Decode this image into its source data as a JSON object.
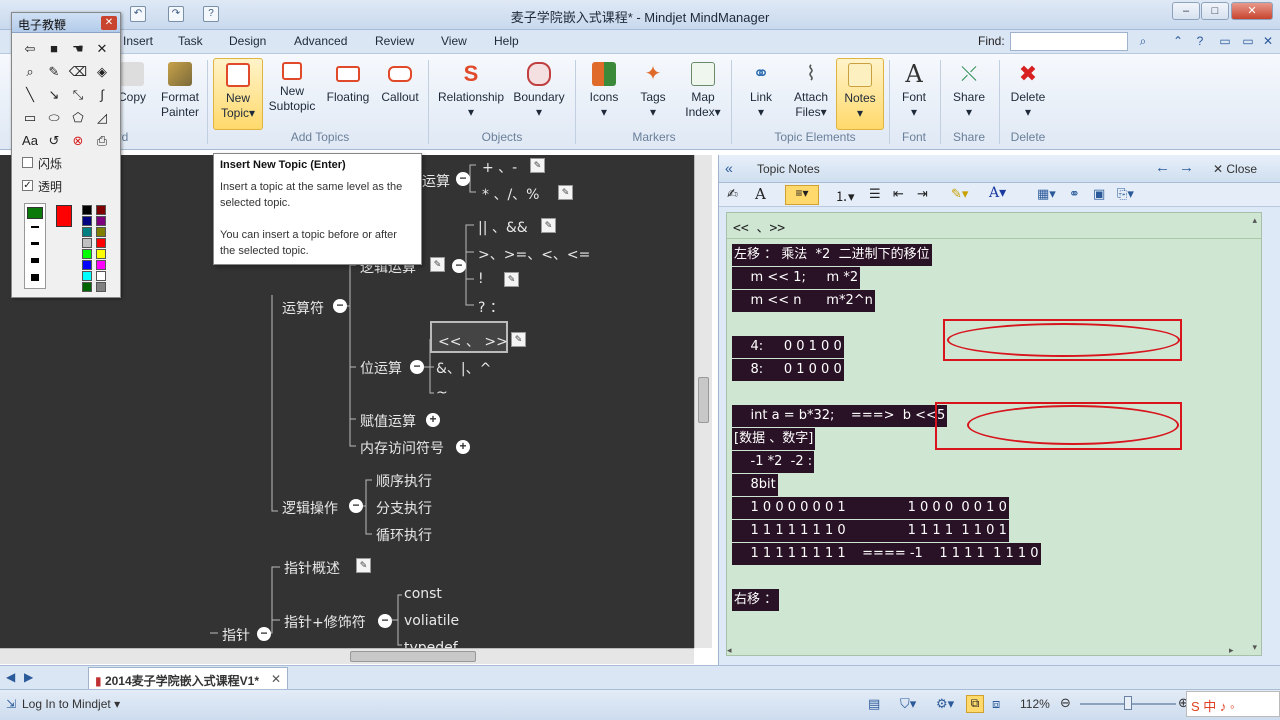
{
  "window": {
    "title": "麦子学院嵌入式课程* - Mindjet MindManager"
  },
  "menubar": {
    "items": [
      "Insert",
      "Task",
      "Design",
      "Advanced",
      "Review",
      "View",
      "Help"
    ],
    "find_label": "Find:"
  },
  "ribbon": {
    "buttons": {
      "copy": "Copy",
      "format_painter_1": "Format",
      "format_painter_2": "Painter",
      "new_topic_1": "New",
      "new_topic_2": "Topic",
      "new_subtopic_1": "New",
      "new_subtopic_2": "Subtopic",
      "floating": "Floating",
      "callout": "Callout",
      "relationship": "Relationship",
      "boundary": "Boundary",
      "icons": "Icons",
      "tags": "Tags",
      "map_index_1": "Map",
      "map_index_2": "Index",
      "link": "Link",
      "attach_files_1": "Attach",
      "attach_files_2": "Files",
      "notes": "Notes",
      "font": "Font",
      "share": "Share",
      "delete": "Delete"
    },
    "groups": {
      "clipboard": "rd",
      "add_topics": "Add Topics",
      "objects": "Objects",
      "markers": "Markers",
      "topic_elements": "Topic Elements",
      "font": "Font",
      "share": "Share",
      "delete": "Delete"
    }
  },
  "palette": {
    "title": "电子教鞭",
    "flash_label": "闪烁",
    "transparent_label": "透明",
    "flash_checked": false,
    "transparent_checked": true,
    "swatches": [
      "#000000",
      "#7f0000",
      "#000080",
      "#7f007f",
      "#008080",
      "#808000",
      "#c0c0c0",
      "#ff0000",
      "#00ff00",
      "#ffff00",
      "#0000ff",
      "#ff00ff",
      "#00ffff",
      "#ffffff",
      "#006400",
      "#808080"
    ],
    "selected_color": "#ff0000"
  },
  "tooltip": {
    "title": "Insert New Topic (Enter)",
    "line1": "Insert a topic at the same level as the selected topic.",
    "line2": "You can insert a topic before or after the selected topic."
  },
  "map": {
    "ops1": "+ 、-",
    "ops2": "* 、/、%",
    "arith_partial": "运算",
    "logic1": "|| 、&&",
    "logic2": ">、>=、<、<=",
    "logic3": "!",
    "logic4": "? ：",
    "logic_op": "逻辑运算",
    "operators": "运算符",
    "shift": "<< 、 >>",
    "bitwise": "位运算",
    "bit_and": "&、|、^",
    "bit_not": "~",
    "assign": "赋值运算",
    "mem_access": "内存访问符号",
    "seq": "顺序执行",
    "branch": "分支执行",
    "loop": "循环执行",
    "logic_ctrl": "逻辑操作",
    "ptr_overview": "指针概述",
    "const": "const",
    "volatile": "voliatile",
    "typedef": "typedef",
    "ptr_mod": "指针+修饰符",
    "pointer": "指针"
  },
  "notes": {
    "header": "Topic Notes",
    "close": "Close",
    "title_text": "<< 、>>",
    "lines": [
      "左移 ： 乘法  *2  二进制下的移位",
      "    m << 1;     m *2",
      "    m << n      m*2^n",
      "",
      "    4:     0 0 1 0 0",
      "    8:     0 1 0 0 0",
      "",
      "    int a = b*32;    ===>  b <<5",
      "[数据 、数字]",
      "    -1 *2  -2 :",
      "    8bit",
      "    1 0 0 0 0 0 0 1               1 0 0 0  0 0 1 0",
      "    1 1 1 1 1 1 1 0               1 1 1 1  1 1 0 1",
      "    1 1 1 1 1 1 1 1    ==== -1    1 1 1 1  1 1 1 0",
      "",
      "右移 ："
    ]
  },
  "tabs": {
    "document": "2014麦子学院嵌入式课程V1*"
  },
  "status": {
    "login": "Log In to Mindjet",
    "zoom": "112%"
  }
}
